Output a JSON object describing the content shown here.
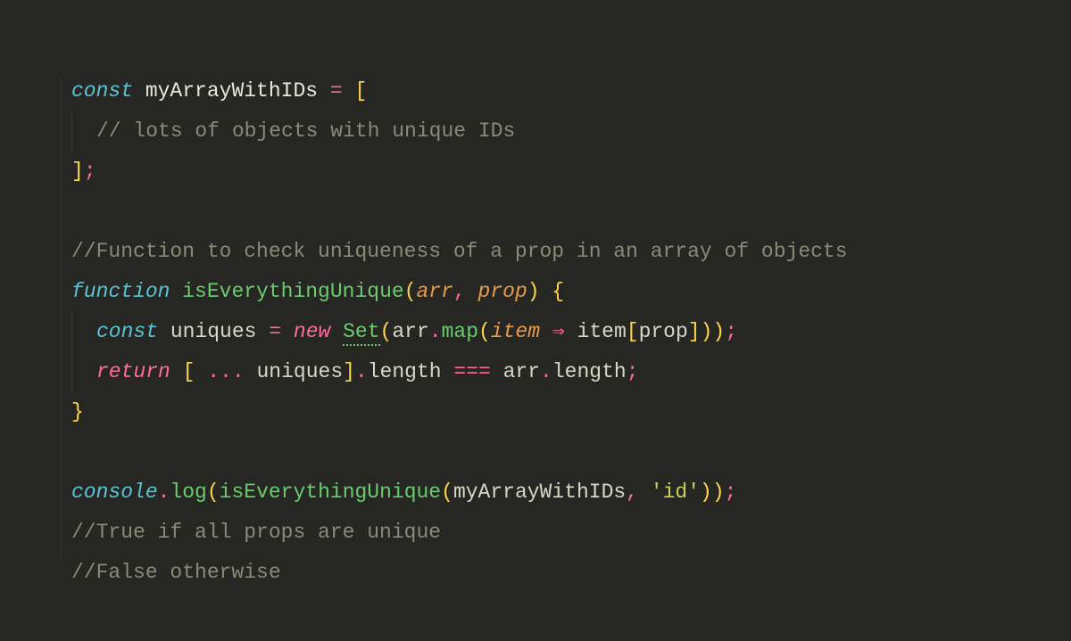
{
  "code": {
    "l1": {
      "kw_const": "const",
      "name": "myArrayWithIDs",
      "eq": "=",
      "open": "["
    },
    "l2": {
      "comment": "// lots of objects with unique IDs"
    },
    "l3": {
      "close": "];"
    },
    "l5": {
      "comment": "//Function to check uniqueness of a prop in an array of objects"
    },
    "l6": {
      "kw_fn": "function",
      "name": "isEverythingUnique",
      "open": "(",
      "p1": "arr",
      "comma": ",",
      "p2": "prop",
      "close": ")",
      "brace": "{"
    },
    "l7": {
      "kw_const": "const",
      "name": "uniques",
      "eq": "=",
      "kw_new": "new",
      "set": "Set",
      "open": "(",
      "arr": "arr",
      "dot": ".",
      "map": "map",
      "open2": "(",
      "item": "item",
      "arrow": "⇒",
      "item2": "item",
      "open3": "[",
      "prop": "prop",
      "close3": "]",
      "close2": ")",
      "close": ")",
      "semi": ";"
    },
    "l8": {
      "kw_return": "return",
      "open": "[",
      "spread": "...",
      "uniques": "uniques",
      "close": "]",
      "dot": ".",
      "length": "length",
      "eqeq": "===",
      "arr": "arr",
      "dot2": ".",
      "length2": "length",
      "semi": ";"
    },
    "l9": {
      "brace": "}"
    },
    "l11": {
      "console": "console",
      "dot": ".",
      "log": "log",
      "open": "(",
      "fn": "isEverythingUnique",
      "open2": "(",
      "arg1": "myArrayWithIDs",
      "comma": ",",
      "str": "'id'",
      "close2": ")",
      "close": ")",
      "semi": ";"
    },
    "l12": {
      "comment": "//True if all props are unique"
    },
    "l13": {
      "comment": "//False otherwise"
    }
  }
}
